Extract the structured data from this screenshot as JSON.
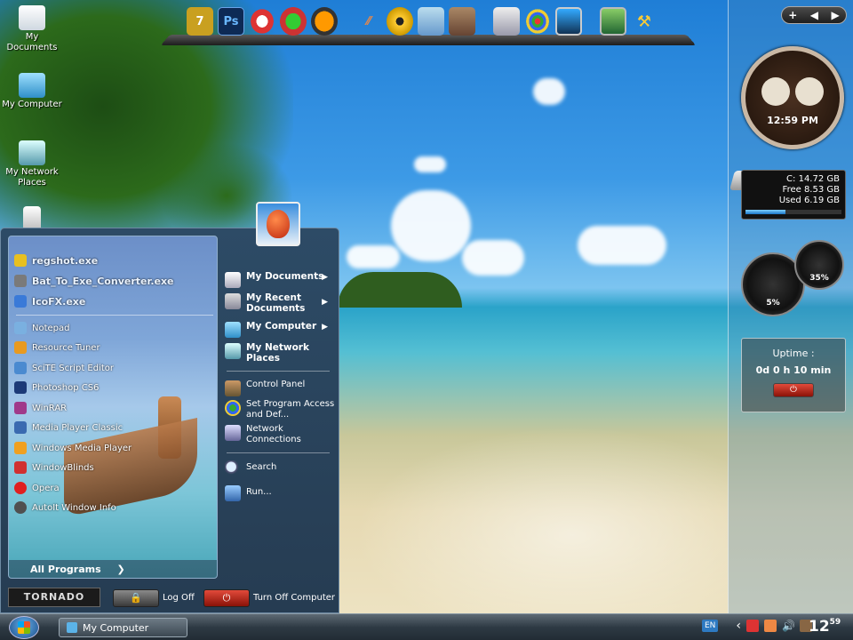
{
  "desktop": {
    "icons": [
      {
        "label": "My Documents",
        "icon": "documents-folder-icon"
      },
      {
        "label": "My Computer",
        "icon": "computer-icon"
      },
      {
        "label": "My Network Places",
        "icon": "network-icon"
      },
      {
        "label": "",
        "icon": "recycle-bin-icon"
      }
    ]
  },
  "dock": {
    "items": [
      "7-zip",
      "Ps",
      "CCleaner",
      "Paint",
      "Avast",
      "Inkscape",
      "Nero",
      "Image Viewer",
      "Screenshot",
      "Calculator",
      "Paint Palette",
      "Monitor",
      "Display",
      "Tools"
    ]
  },
  "sidebar": {
    "controls": [
      "+",
      "◀",
      "▶"
    ],
    "clock_time": "12:59 PM",
    "drive": {
      "line1": "C:  14.72 GB",
      "line2": "Free 8.53 GB",
      "line3": "Used 6.19 GB",
      "used_fraction": 0.42
    },
    "gauge_cpu": "5%",
    "gauge_mem": "35%",
    "uptime_title": "Uptime :",
    "uptime_value": "0d 0 h 10 min",
    "uptime_button": "⏻"
  },
  "start_menu": {
    "pinned": [
      {
        "label": "regshot.exe",
        "color": "#e8c020"
      },
      {
        "label": "Bat_To_Exe_Converter.exe",
        "color": "#7a7a7a"
      },
      {
        "label": "IcoFX.exe",
        "color": "#3a7ad8"
      }
    ],
    "recent": [
      {
        "label": "Notepad",
        "color": "#7ab0e0"
      },
      {
        "label": "Resource Tuner",
        "color": "#e89a20"
      },
      {
        "label": "SciTE Script Editor",
        "color": "#4a8ad0"
      },
      {
        "label": "Photoshop CS6",
        "color": "#1c3a78"
      },
      {
        "label": "WinRAR",
        "color": "#a03a8a"
      },
      {
        "label": "Media Player Classic",
        "color": "#3a6ab0"
      },
      {
        "label": "Windows Media Player",
        "color": "#f0a020"
      },
      {
        "label": "WindowBlinds",
        "color": "#d03030"
      },
      {
        "label": "Opera",
        "color": "#e02020"
      },
      {
        "label": "AutoIt Window Info",
        "color": "#505050"
      }
    ],
    "all_programs": "All Programs",
    "all_programs_arrow": "❯",
    "places": [
      {
        "label": "My Documents",
        "bold": true,
        "arrow": "▶"
      },
      {
        "label": "My Recent Documents",
        "bold": true,
        "arrow": "▶"
      },
      {
        "label": "My Computer",
        "bold": true,
        "arrow": "▶"
      },
      {
        "label": "My Network Places",
        "bold": true,
        "arrow": ""
      }
    ],
    "system": [
      {
        "label": "Control Panel"
      },
      {
        "label": "Set Program Access and Def..."
      },
      {
        "label": "Network Connections"
      }
    ],
    "tools": [
      {
        "label": "Search"
      },
      {
        "label": "Run..."
      }
    ],
    "logo_text": "TORNADO",
    "log_off": "Log Off",
    "turn_off": "Turn Off Computer"
  },
  "taskbar": {
    "task_label": "My Computer",
    "lang": "EN",
    "tray_arrow": "‹",
    "time": "12",
    "time_minutes": "59"
  }
}
